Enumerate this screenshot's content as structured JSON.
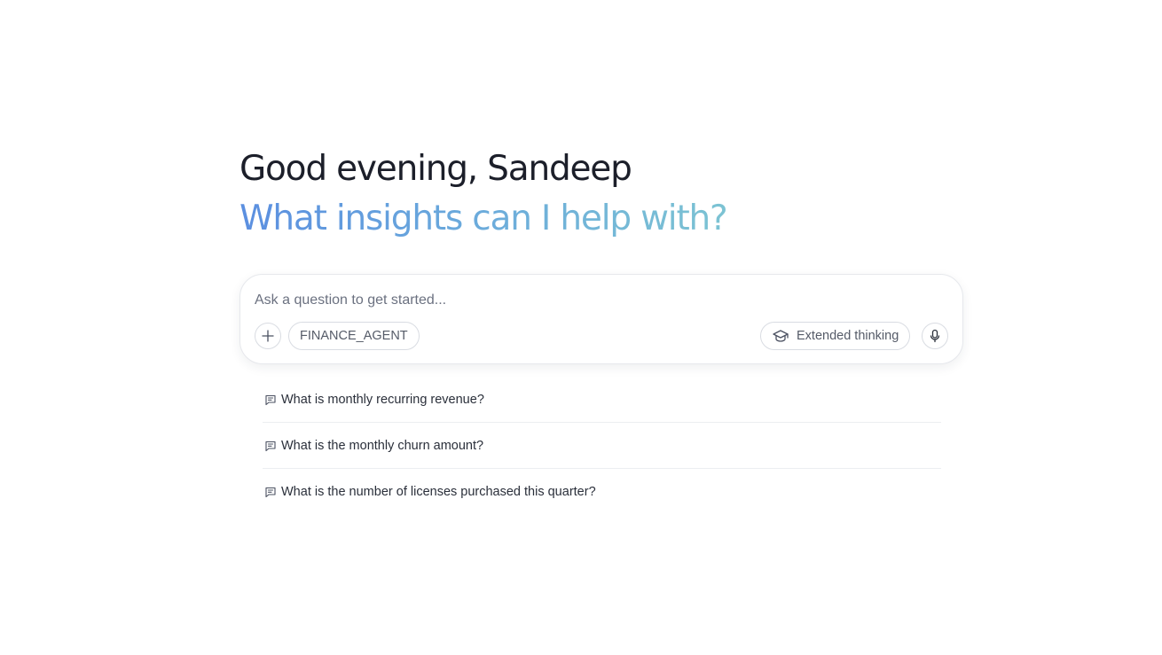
{
  "header": {
    "greeting": "Good evening, Sandeep",
    "subheading": "What insights can I help with?"
  },
  "composer": {
    "placeholder": "Ask a question to get started...",
    "value": "",
    "agent_label": "FINANCE_AGENT",
    "extended_thinking_label": "Extended thinking",
    "icons": {
      "add": "plus-icon",
      "thinking": "graduation-cap-icon",
      "voice": "microphone-icon"
    }
  },
  "suggestions": [
    {
      "icon": "message-icon",
      "text": "What is monthly recurring revenue?"
    },
    {
      "icon": "message-icon",
      "text": "What is the monthly churn amount?"
    },
    {
      "icon": "message-icon",
      "text": "What is the number of licenses purchased this quarter?"
    }
  ],
  "colors": {
    "heading": "#1c1f2a",
    "gradient_start": "#5b8fe0",
    "gradient_end": "#7cc3d3",
    "border": "#d9dce2",
    "muted_text": "#555b68"
  }
}
